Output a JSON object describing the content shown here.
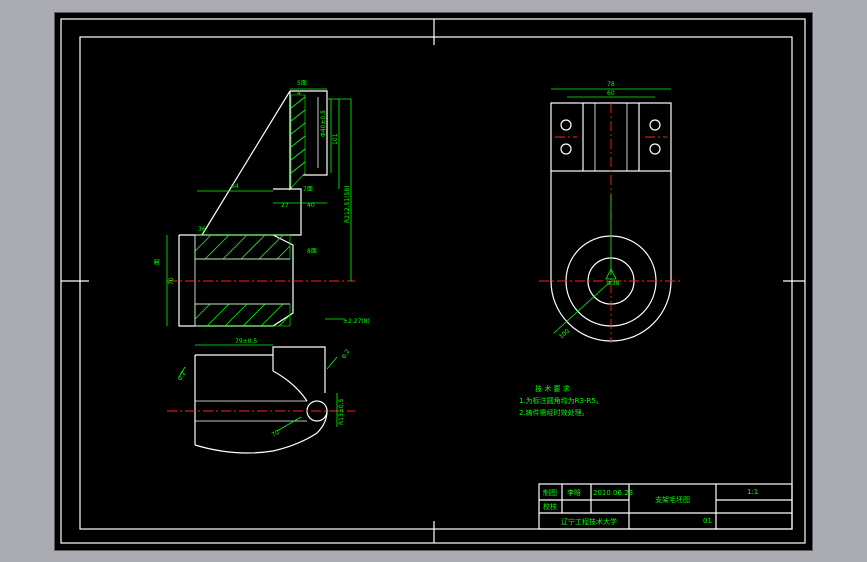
{
  "drawing": {
    "title_block": {
      "drawn_label": "制图",
      "drawn_by": "李晗",
      "date": "2010.06.23",
      "part_name": "支架毛坯图",
      "scale": "1:1",
      "checked_label": "校核",
      "school": "辽宁工程技术大学",
      "sheet_no": "01"
    },
    "tech_req": {
      "title": "技 术 要 求",
      "items": [
        "1.为标注圆角均为R3-R5。",
        "2.铸件需经时效处理。"
      ]
    },
    "dims": {
      "top_left_a": "5面",
      "top_left_b": "4",
      "vert_1": "Φ40±0.5",
      "vert_2": "101",
      "vert_3": "R212.51(58)",
      "face_1": "7面",
      "width_1": "27",
      "width_2": "40",
      "face_2": "8面",
      "face_3": "面",
      "dia_left": "70",
      "taper": "36",
      "diag": "64",
      "tol_note": "±2.27(8)",
      "bottom_len": "79±0.5",
      "angle_r": "0.2",
      "angle_l": "0.2",
      "vert_4": "R13±0.5",
      "diag_2": "70",
      "right_w1": "78",
      "right_w2": "60",
      "right_dia": "Φ38",
      "right_diag": "100"
    }
  }
}
